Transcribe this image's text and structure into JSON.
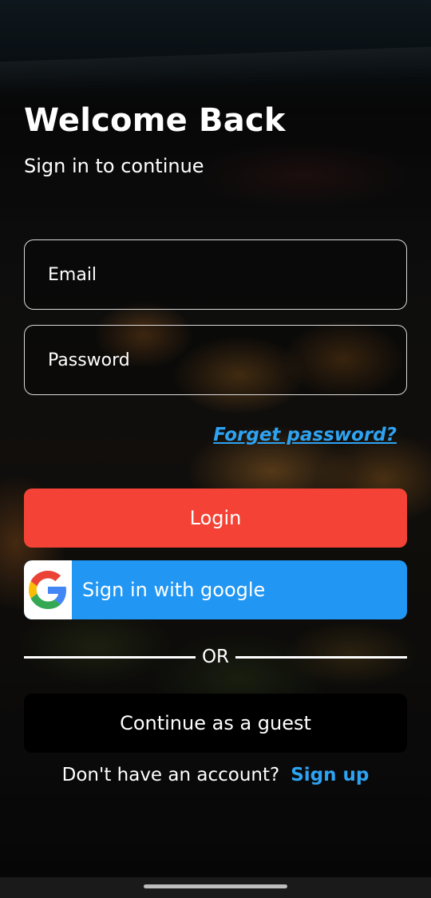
{
  "header": {
    "title": "Welcome Back",
    "subtitle": "Sign in to continue"
  },
  "form": {
    "email": {
      "value": "",
      "placeholder": "Email"
    },
    "password": {
      "value": "",
      "placeholder": "Password"
    },
    "forget_password_link": "Forget password?"
  },
  "actions": {
    "login_label": "Login",
    "google_label": "Sign in with google",
    "google_icon": "google-g-icon",
    "or_text": "OR",
    "guest_label": "Continue as a guest"
  },
  "footer": {
    "no_account_text": "Don't have an account?",
    "signup_link": "Sign up"
  },
  "colors": {
    "login_button": "#f44336",
    "google_button": "#2196f3",
    "link": "#2ea3f2",
    "guest_button": "#000000"
  }
}
